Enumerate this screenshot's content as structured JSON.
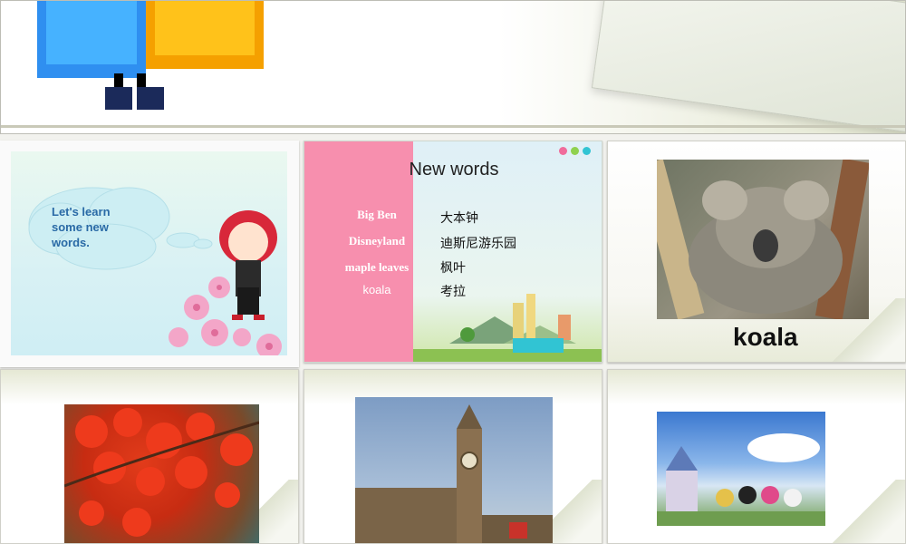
{
  "slides": {
    "learn": {
      "cloud_text": "Let's learn some new words."
    },
    "words": {
      "title": "New words",
      "items": [
        {
          "en": "Big Ben",
          "zh": "大本钟"
        },
        {
          "en": "Disneyland",
          "zh": "迪斯尼游乐园"
        },
        {
          "en": "maple leaves",
          "zh": "枫叶"
        },
        {
          "en": "koala",
          "zh": "考拉"
        }
      ]
    },
    "koala": {
      "caption": "koala"
    }
  },
  "colors": {
    "pink_panel": "#f78fae",
    "cloud_text": "#2a6aa6",
    "dot_pink": "#f06c9b",
    "dot_green": "#8fd14f",
    "dot_teal": "#31c4d3"
  }
}
